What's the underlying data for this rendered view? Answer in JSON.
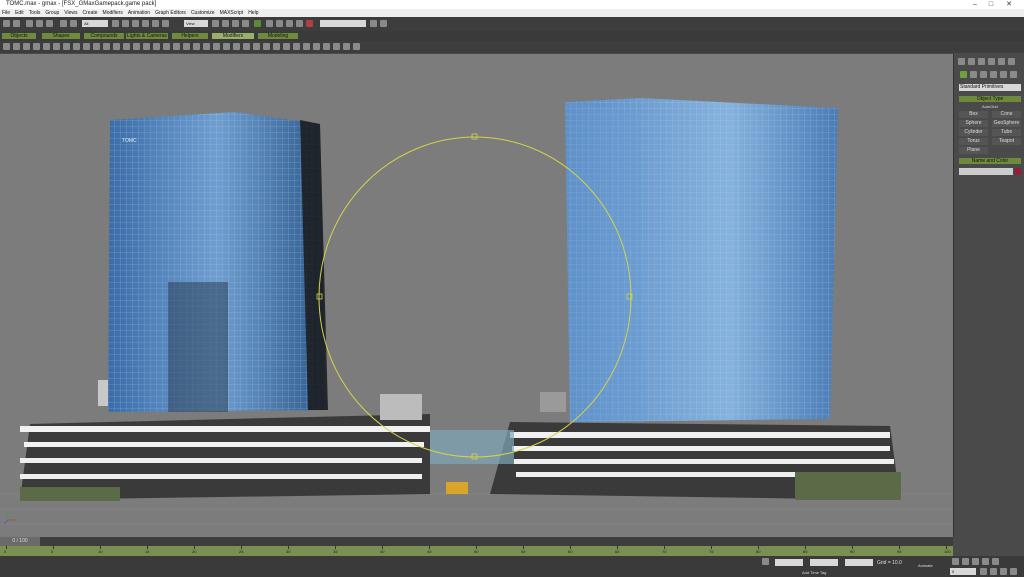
{
  "window": {
    "title": "TOMC.max - gmax - [FSX_GMaxGamepack.game pack]"
  },
  "menu": {
    "items": [
      "File",
      "Edit",
      "Tools",
      "Group",
      "Views",
      "Create",
      "Modifiers",
      "Animation",
      "Graph Editors",
      "Customize",
      "MAXScript",
      "Help"
    ]
  },
  "toolbar": {
    "selection_filter": "All",
    "ref_coord": "View",
    "named_selection": ""
  },
  "tabs": [
    {
      "label": "Objects"
    },
    {
      "label": "Shapes"
    },
    {
      "label": "Compounds"
    },
    {
      "label": "Lights & Cameras"
    },
    {
      "label": "Helpers"
    },
    {
      "label": "Modifiers"
    },
    {
      "label": "Modeling"
    }
  ],
  "command_panel": {
    "category": "Standard Primitives",
    "section_object_type": "Object Type",
    "autogrid": "AutoGrid",
    "buttons": [
      "Box",
      "Cone",
      "Sphere",
      "GeoSphere",
      "Cylinder",
      "Tube",
      "Torus",
      "Teapot",
      "Plane"
    ],
    "section_name_color": "Name and Color"
  },
  "timeline": {
    "slider": "0 / 100",
    "ticks": [
      "0",
      "5",
      "10",
      "15",
      "20",
      "25",
      "30",
      "35",
      "40",
      "45",
      "50",
      "55",
      "60",
      "65",
      "70",
      "75",
      "80",
      "85",
      "90",
      "95",
      "100"
    ]
  },
  "status": {
    "add_time_tag": "Add Time Tag",
    "grid": "Grid = 10.0",
    "animate": "Animate",
    "frame": "0"
  },
  "viewport": {
    "building_sign": "TOMC"
  },
  "colors": {
    "viewport_bg": "#7c7c7c",
    "tab_green": "#6e8b3d",
    "spline_yellow": "#d6d14a",
    "object_color": "#9a1a3c"
  }
}
